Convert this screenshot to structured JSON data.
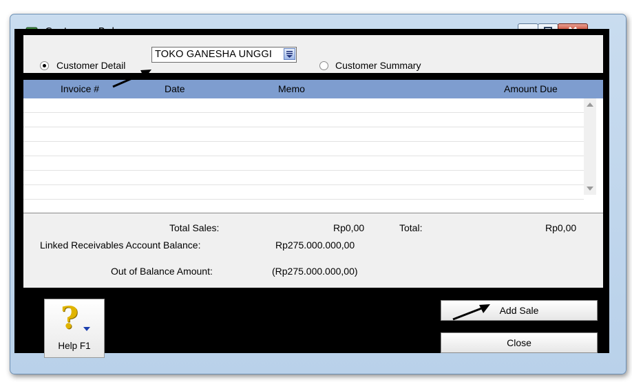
{
  "window": {
    "title": "Customer Balances"
  },
  "filter": {
    "customer_detail_label": "Customer Detail",
    "customer_detail_selected": true,
    "customer_value": "TOKO GANESHA UNGGI",
    "customer_summary_label": "Customer Summary",
    "customer_summary_selected": false
  },
  "table": {
    "columns": [
      "Invoice #",
      "Date",
      "Memo",
      "Amount Due"
    ],
    "rows": []
  },
  "summary": {
    "total_sales_label": "Total Sales:",
    "total_sales_value": "Rp0,00",
    "total_label": "Total:",
    "total_value": "Rp0,00",
    "linked_label": "Linked Receivables Account Balance:",
    "linked_value": "Rp275.000.000,00",
    "out_of_balance_label": "Out of Balance Amount:",
    "out_of_balance_value": "(Rp275.000.000,00)"
  },
  "buttons": {
    "help_label": "Help F1",
    "add_sale_label": "Add Sale",
    "close_label": "Close"
  },
  "colors": {
    "header_blue": "#7e9dcf",
    "panel_gray": "#f0f0f0",
    "frame_black": "#000000"
  },
  "icons": [
    "app-icon",
    "minimize-icon",
    "maximize-icon",
    "close-icon",
    "dropdown-icon",
    "help-icon",
    "annotation-arrow-icon"
  ]
}
